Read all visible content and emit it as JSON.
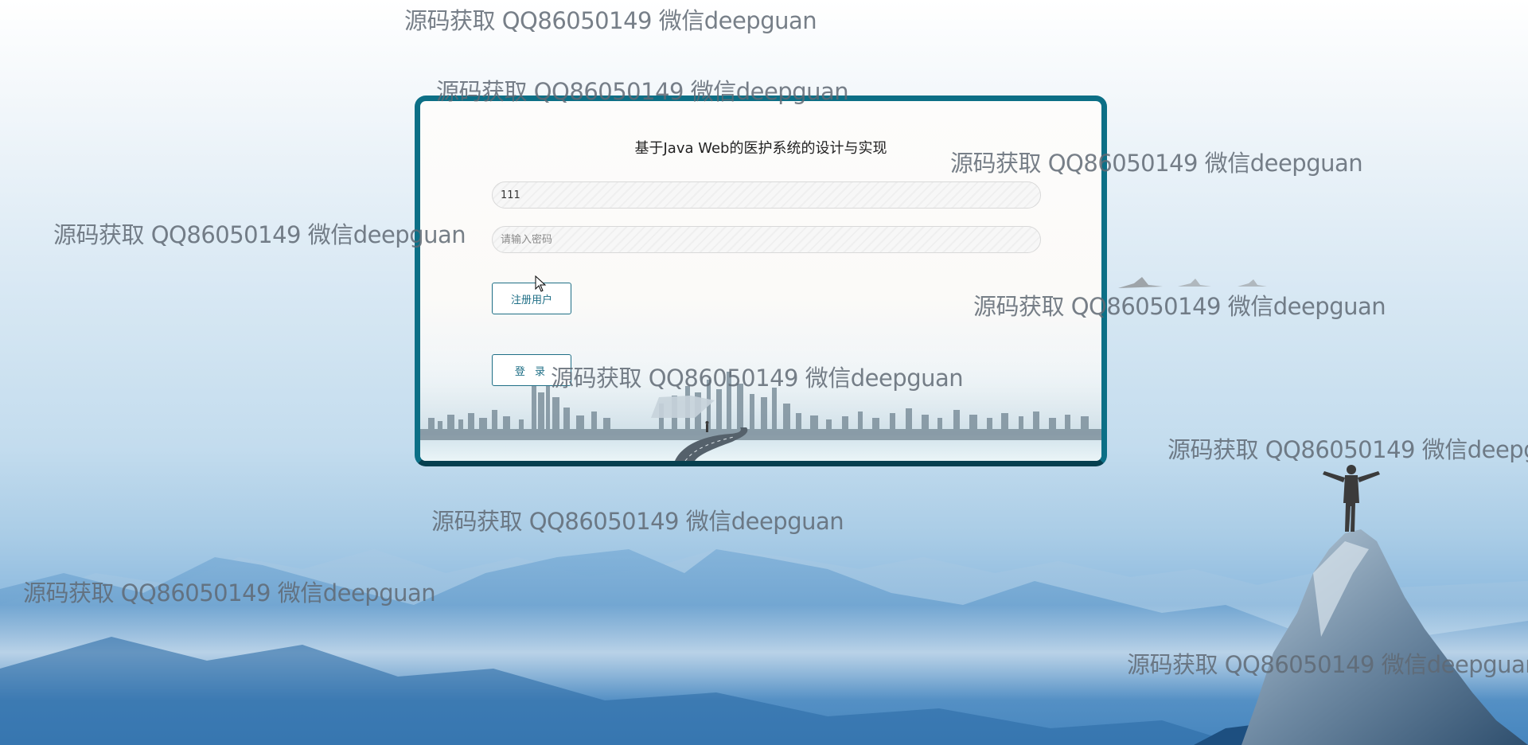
{
  "login": {
    "title": "基于Java Web的医护系统的设计与实现",
    "username_value": "111",
    "password_placeholder": "请输入密码",
    "register_label": "注册用户",
    "login_label": "登 录"
  },
  "watermark": {
    "text": "源码获取 QQ86050149 微信deepguan"
  },
  "colors": {
    "card_border": "#0c6f86",
    "button_text": "#1f6f86",
    "sky_top": "#ffffff",
    "mountains": "#5b97c9"
  },
  "icons": {
    "cursor": "arrow-cursor-icon"
  }
}
